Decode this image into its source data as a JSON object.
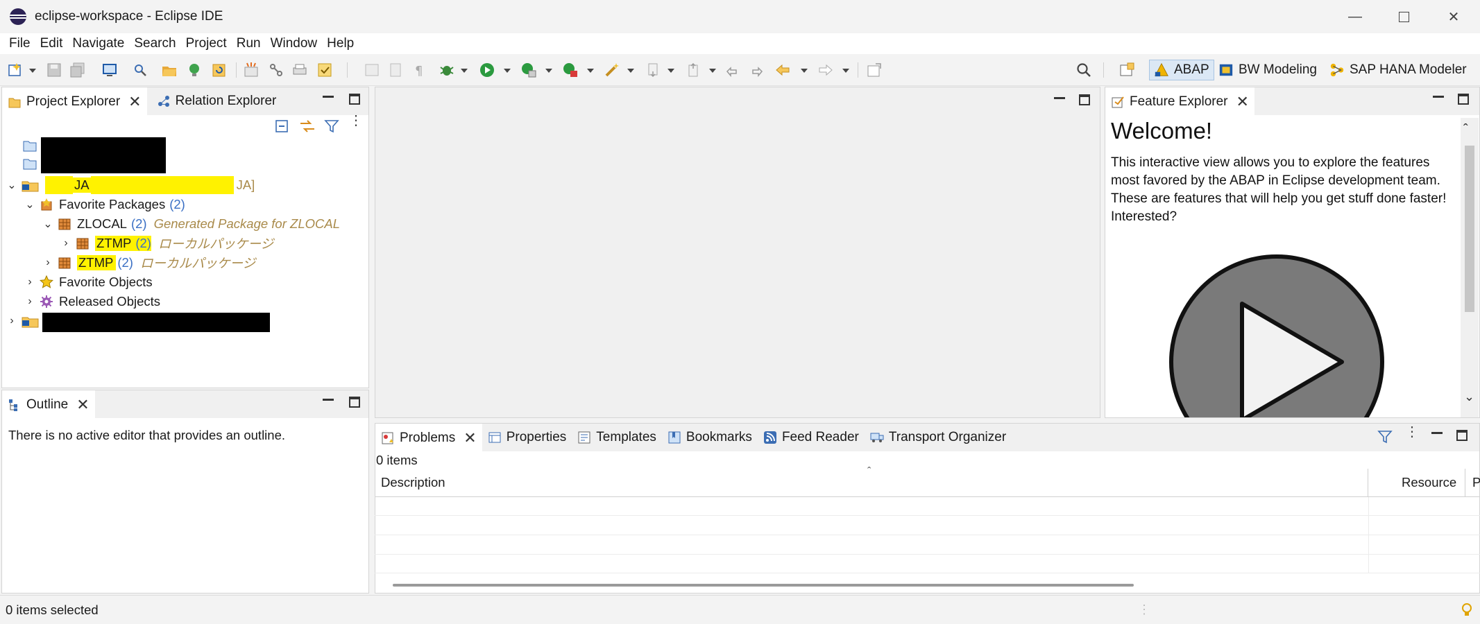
{
  "window": {
    "title": "eclipse-workspace - Eclipse IDE"
  },
  "menu": [
    {
      "label": "File"
    },
    {
      "label": "Edit"
    },
    {
      "label": "Navigate"
    },
    {
      "label": "Search"
    },
    {
      "label": "Project"
    },
    {
      "label": "Run"
    },
    {
      "label": "Window"
    },
    {
      "label": "Help"
    }
  ],
  "perspectives": [
    {
      "label": "ABAP",
      "active": true,
      "icon": "abap-perspective-icon"
    },
    {
      "label": "BW Modeling",
      "active": false,
      "icon": "bw-modeling-icon"
    },
    {
      "label": "SAP HANA Modeler",
      "active": false,
      "icon": "hana-modeler-icon"
    }
  ],
  "project_explorer": {
    "tabs": [
      {
        "label": "Project Explorer",
        "active": true
      },
      {
        "label": "Relation Explorer",
        "active": false
      }
    ],
    "tree": {
      "project_prefix": "JA",
      "project_suffix": "JA]",
      "favorite_packages": {
        "label": "Favorite Packages",
        "count": "(2)"
      },
      "zlocal": {
        "label": "ZLOCAL",
        "count": "(2)",
        "desc": "Generated Package for ZLOCAL"
      },
      "ztmp_child": {
        "label": "ZTMP",
        "count": "(2)",
        "desc": "ローカルパッケージ"
      },
      "ztmp": {
        "label": "ZTMP",
        "count": "(2)",
        "desc": "ローカルパッケージ"
      },
      "favorite_objects": {
        "label": "Favorite Objects"
      },
      "released_objects": {
        "label": "Released Objects"
      }
    }
  },
  "outline": {
    "tab": "Outline",
    "message": "There is no active editor that provides an outline."
  },
  "feature_explorer": {
    "tab": "Feature Explorer",
    "title": "Welcome!",
    "text": "This interactive view allows you to explore the features most favored by the ABAP in Eclipse development team. These are features that will help you get stuff done faster! Interested?"
  },
  "bottom_tabs": [
    {
      "label": "Problems",
      "active": true
    },
    {
      "label": "Properties",
      "active": false
    },
    {
      "label": "Templates",
      "active": false
    },
    {
      "label": "Bookmarks",
      "active": false
    },
    {
      "label": "Feed Reader",
      "active": false
    },
    {
      "label": "Transport Organizer",
      "active": false
    }
  ],
  "problems": {
    "count_text": "0 items",
    "columns": [
      {
        "label": "Description"
      },
      {
        "label": "Resource"
      },
      {
        "label": "P"
      }
    ]
  },
  "status": {
    "text": "0 items selected"
  },
  "colors": {
    "accent": "#3a6fc4",
    "highlight": "#fff200",
    "desc": "#a98a4a",
    "play": "#7a7a7a"
  }
}
